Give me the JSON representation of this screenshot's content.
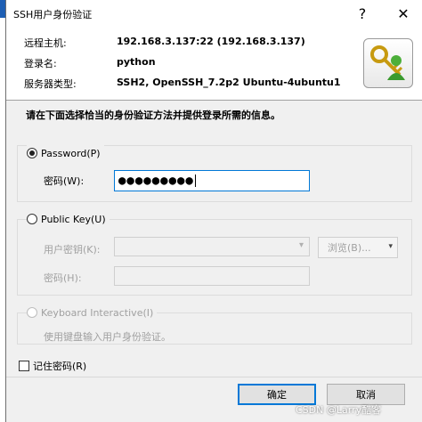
{
  "window": {
    "title": "SSH用户身份验证",
    "help_glyph": "?",
    "close_glyph": "✕"
  },
  "info": {
    "host_label": "远程主机:",
    "host_value": "192.168.3.137:22 (192.168.3.137)",
    "user_label": "登录名:",
    "user_value": "python",
    "server_label": "服务器类型:",
    "server_value": "SSH2, OpenSSH_7.2p2 Ubuntu-4ubuntu1"
  },
  "instruction": "请在下面选择恰当的身份验证方法并提供登录所需的信息。",
  "password_group": {
    "radio_label": "Password(P)",
    "checked": true,
    "field_label": "密码(W):",
    "field_value": "●●●●●●●●●"
  },
  "publickey_group": {
    "radio_label": "Public Key(U)",
    "checked": false,
    "key_label": "用户密钥(K):",
    "key_arrow": "▾",
    "passphrase_label": "密码(H):",
    "browse_label": "浏览(B)...",
    "browse_arrow": "▾"
  },
  "keyboard_group": {
    "radio_label": "Keyboard Interactive(I)",
    "description": "使用键盘输入用户身份验证。"
  },
  "remember_label": "记住密码(R)",
  "buttons": {
    "ok": "确定",
    "cancel": "取消"
  },
  "watermark": "CSDN @Larry酷客",
  "colors": {
    "accent": "#0078d7",
    "panel_bg": "#f0f0f0",
    "disabled_text": "#a0a0a0"
  },
  "icons": {
    "logo": "key-user-icon"
  }
}
